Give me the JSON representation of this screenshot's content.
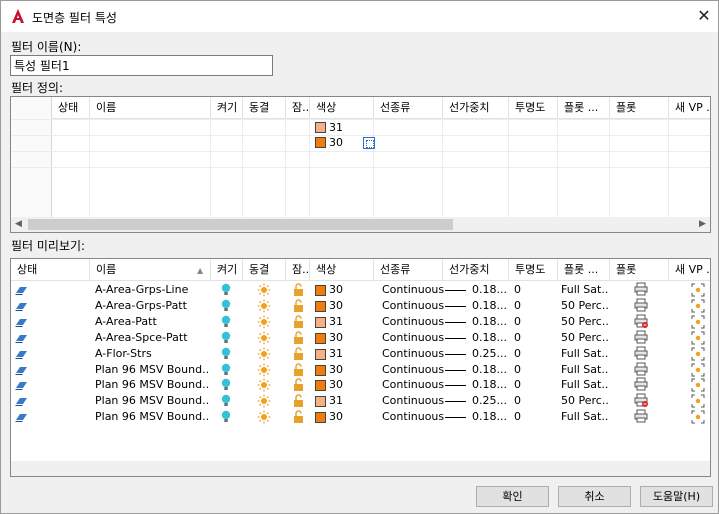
{
  "window": {
    "title": "도면층 필터 특성",
    "close": "✕"
  },
  "filter_name": {
    "label": "필터 이름(N):",
    "value": "특성 필터1"
  },
  "definition": {
    "label": "필터 정의:",
    "columns": [
      "상태",
      "이름",
      "켜기",
      "동결",
      "잠..",
      "색상",
      "선종류",
      "선가중치",
      "투명도",
      "플롯 ...",
      "플롯",
      "새 VP ..."
    ],
    "rows": [
      {
        "color": "31",
        "swatch": "#f4b183"
      },
      {
        "color": "30",
        "swatch": "#f07c0c"
      }
    ]
  },
  "preview": {
    "label": "필터 미리보기:",
    "columns": [
      "상태",
      "이름",
      "켜기",
      "동결",
      "잠..",
      "색상",
      "선종류",
      "선가중치",
      "투명도",
      "플롯 ...",
      "플롯",
      "새 VP ..."
    ],
    "rows": [
      {
        "name": "A-Area-Grps-Line",
        "color": "30",
        "swatch": "#f07c0c",
        "linetype": "Continuous",
        "lineweight": "0.18...",
        "transparency": "0",
        "plot_style": "Full Sat...",
        "plot_off": false
      },
      {
        "name": "A-Area-Grps-Patt",
        "color": "30",
        "swatch": "#f07c0c",
        "linetype": "Continuous",
        "lineweight": "0.18...",
        "transparency": "0",
        "plot_style": "50 Perc...",
        "plot_off": false
      },
      {
        "name": "A-Area-Patt",
        "color": "31",
        "swatch": "#f4b183",
        "linetype": "Continuous",
        "lineweight": "0.18...",
        "transparency": "0",
        "plot_style": "50 Perc...",
        "plot_off": true
      },
      {
        "name": "A-Area-Spce-Patt",
        "color": "30",
        "swatch": "#f07c0c",
        "linetype": "Continuous",
        "lineweight": "0.18...",
        "transparency": "0",
        "plot_style": "50 Perc...",
        "plot_off": false
      },
      {
        "name": "A-Flor-Strs",
        "color": "31",
        "swatch": "#f4b183",
        "linetype": "Continuous",
        "lineweight": "0.25...",
        "transparency": "0",
        "plot_style": "Full Sat...",
        "plot_off": false
      },
      {
        "name": "Plan 96 MSV Bound...",
        "color": "30",
        "swatch": "#f07c0c",
        "linetype": "Continuous",
        "lineweight": "0.18...",
        "transparency": "0",
        "plot_style": "Full Sat...",
        "plot_off": false
      },
      {
        "name": "Plan 96 MSV Bound...",
        "color": "30",
        "swatch": "#f07c0c",
        "linetype": "Continuous",
        "lineweight": "0.18...",
        "transparency": "0",
        "plot_style": "Full Sat...",
        "plot_off": false
      },
      {
        "name": "Plan 96 MSV Bound...",
        "color": "31",
        "swatch": "#f4b183",
        "linetype": "Continuous",
        "lineweight": "0.25...",
        "transparency": "0",
        "plot_style": "50 Perc...",
        "plot_off": true
      },
      {
        "name": "Plan 96 MSV Bound...",
        "color": "30",
        "swatch": "#f07c0c",
        "linetype": "Continuous",
        "lineweight": "0.18...",
        "transparency": "0",
        "plot_style": "Full Sat...",
        "plot_off": false
      }
    ]
  },
  "buttons": {
    "ok": "확인",
    "cancel": "취소",
    "help": "도움말(H)"
  },
  "colors": {
    "autocad_red": "#c8102e",
    "layer_blue": "#3a78c8",
    "bulb_cyan": "#35c2d8",
    "sun_orange": "#f2a01e",
    "lock_orange": "#e8a12a"
  }
}
